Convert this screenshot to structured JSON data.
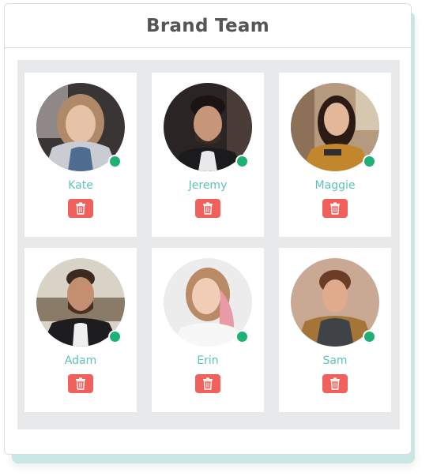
{
  "card": {
    "title": "Brand Team"
  },
  "colors": {
    "name_text": "#5dc3b8",
    "status_online": "#1db173",
    "delete_button": "#f0605d",
    "accent_shadow": "#c8e7e4"
  },
  "members": [
    {
      "name": "Kate",
      "status": "online",
      "delete_icon": "trash-icon"
    },
    {
      "name": "Jeremy",
      "status": "online",
      "delete_icon": "trash-icon"
    },
    {
      "name": "Maggie",
      "status": "online",
      "delete_icon": "trash-icon"
    },
    {
      "name": "Adam",
      "status": "online",
      "delete_icon": "trash-icon"
    },
    {
      "name": "Erin",
      "status": "online",
      "delete_icon": "trash-icon"
    },
    {
      "name": "Sam",
      "status": "online",
      "delete_icon": "trash-icon"
    }
  ]
}
